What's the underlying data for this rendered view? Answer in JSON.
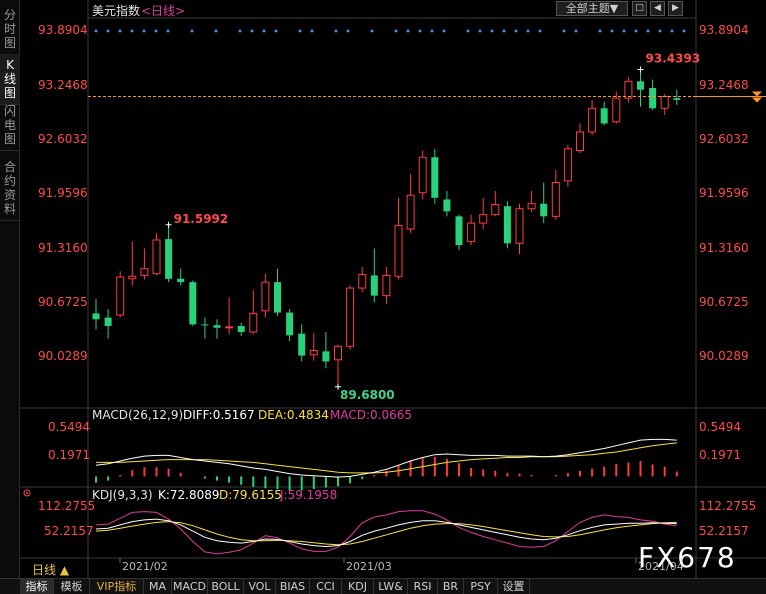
{
  "header": {
    "title": "美元指数",
    "period": "<日线>",
    "theme_button": "全部主题▼",
    "mini_buttons": [
      "□",
      "◀",
      "▶"
    ]
  },
  "left_nav": [
    {
      "label": "分时图",
      "active": false
    },
    {
      "label": "K线图",
      "active": true
    },
    {
      "label": "闪电图",
      "active": false
    },
    {
      "label": "合约资料",
      "active": false
    }
  ],
  "price_axis": {
    "ticks": [
      "93.8904",
      "93.2468",
      "92.6032",
      "91.9596",
      "91.3160",
      "90.6725",
      "90.0289"
    ]
  },
  "annotations": {
    "high": "93.4393",
    "mid_high": "91.5992",
    "low": "89.6800"
  },
  "macd": {
    "title": "MACD(26,12,9)",
    "diff": "DIFF:0.5167",
    "dea": "DEA:0.4834",
    "macd": "MACD:0.0665",
    "ticks": [
      "0.5494",
      "0.1971"
    ]
  },
  "kdj": {
    "title": "KDJ(9,3,3)",
    "k": "K:72.8089",
    "d": "D:79.6155",
    "j": "J:59.1958",
    "ticks": [
      "112.2755",
      "52.2157"
    ]
  },
  "x_axis": {
    "period": "日线 ▲",
    "dates": [
      "2021/02",
      "2021/03",
      "2021/04"
    ]
  },
  "bottom_tabs": [
    "指标",
    "模板",
    "VIP指标",
    "MA",
    "MACD",
    "BOLL",
    "VOL",
    "BIAS",
    "CCI",
    "KDJ",
    "LW&",
    "RSI",
    "BR",
    "PSY",
    "设置"
  ],
  "watermark": "FX678",
  "colors": {
    "up": "#ff3b3b",
    "down": "#28d27a",
    "diff": "#ffffff",
    "dea": "#ffe033",
    "macd": "#e03aa0",
    "current_price_line": "#ff9a1e"
  },
  "chart_data": {
    "type": "candlestick",
    "title": "美元指数 <日线>",
    "ylim": [
      89.5,
      94.05
    ],
    "y_ticks": [
      93.8904,
      93.2468,
      92.6032,
      91.9596,
      91.316,
      90.6725,
      90.0289
    ],
    "x_labels": [
      "2021/02",
      "2021/03",
      "2021/04"
    ],
    "current_price": 93.12,
    "candles": [
      {
        "o": 90.55,
        "c": 90.48,
        "h": 90.72,
        "l": 90.36
      },
      {
        "o": 90.5,
        "c": 90.4,
        "h": 90.6,
        "l": 90.25
      },
      {
        "o": 90.53,
        "c": 90.98,
        "h": 91.05,
        "l": 90.5
      },
      {
        "o": 90.96,
        "c": 90.99,
        "h": 91.4,
        "l": 90.88
      },
      {
        "o": 91.0,
        "c": 91.08,
        "h": 91.32,
        "l": 90.95
      },
      {
        "o": 91.02,
        "c": 91.42,
        "h": 91.5,
        "l": 91.0
      },
      {
        "o": 91.43,
        "c": 90.96,
        "h": 91.6,
        "l": 90.92
      },
      {
        "o": 90.96,
        "c": 90.92,
        "h": 91.08,
        "l": 90.88
      },
      {
        "o": 90.92,
        "c": 90.42,
        "h": 90.94,
        "l": 90.4
      },
      {
        "o": 90.42,
        "c": 90.41,
        "h": 90.5,
        "l": 90.25
      },
      {
        "o": 90.41,
        "c": 90.38,
        "h": 90.48,
        "l": 90.25
      },
      {
        "o": 90.38,
        "c": 90.39,
        "h": 90.74,
        "l": 90.3
      },
      {
        "o": 90.4,
        "c": 90.33,
        "h": 90.44,
        "l": 90.28
      },
      {
        "o": 90.33,
        "c": 90.55,
        "h": 90.82,
        "l": 90.3
      },
      {
        "o": 90.58,
        "c": 90.92,
        "h": 91.02,
        "l": 90.5
      },
      {
        "o": 90.92,
        "c": 90.56,
        "h": 91.08,
        "l": 90.52
      },
      {
        "o": 90.56,
        "c": 90.29,
        "h": 90.6,
        "l": 90.22
      },
      {
        "o": 90.31,
        "c": 90.05,
        "h": 90.42,
        "l": 89.98
      },
      {
        "o": 90.06,
        "c": 90.11,
        "h": 90.32,
        "l": 89.99
      },
      {
        "o": 90.1,
        "c": 89.98,
        "h": 90.33,
        "l": 89.9
      },
      {
        "o": 90.0,
        "c": 90.16,
        "h": 90.18,
        "l": 89.68
      },
      {
        "o": 90.16,
        "c": 90.85,
        "h": 90.88,
        "l": 90.12
      },
      {
        "o": 90.85,
        "c": 91.01,
        "h": 91.1,
        "l": 90.8
      },
      {
        "o": 91.0,
        "c": 90.76,
        "h": 91.32,
        "l": 90.68
      },
      {
        "o": 90.76,
        "c": 91.0,
        "h": 91.1,
        "l": 90.66
      },
      {
        "o": 90.99,
        "c": 91.59,
        "h": 91.92,
        "l": 90.95
      },
      {
        "o": 91.55,
        "c": 91.95,
        "h": 92.2,
        "l": 91.5
      },
      {
        "o": 91.98,
        "c": 92.4,
        "h": 92.48,
        "l": 91.9
      },
      {
        "o": 92.4,
        "c": 91.92,
        "h": 92.5,
        "l": 91.85
      },
      {
        "o": 91.9,
        "c": 91.76,
        "h": 92.0,
        "l": 91.7
      },
      {
        "o": 91.7,
        "c": 91.36,
        "h": 91.72,
        "l": 91.3
      },
      {
        "o": 91.4,
        "c": 91.62,
        "h": 91.72,
        "l": 91.36
      },
      {
        "o": 91.62,
        "c": 91.72,
        "h": 91.92,
        "l": 91.55
      },
      {
        "o": 91.72,
        "c": 91.84,
        "h": 92.0,
        "l": 91.7
      },
      {
        "o": 91.82,
        "c": 91.38,
        "h": 91.88,
        "l": 91.32
      },
      {
        "o": 91.38,
        "c": 91.79,
        "h": 91.85,
        "l": 91.25
      },
      {
        "o": 91.79,
        "c": 91.85,
        "h": 92.0,
        "l": 91.75
      },
      {
        "o": 91.85,
        "c": 91.7,
        "h": 92.1,
        "l": 91.62
      },
      {
        "o": 91.7,
        "c": 92.1,
        "h": 92.25,
        "l": 91.66
      },
      {
        "o": 92.12,
        "c": 92.5,
        "h": 92.55,
        "l": 92.05
      },
      {
        "o": 92.48,
        "c": 92.7,
        "h": 92.8,
        "l": 92.45
      },
      {
        "o": 92.7,
        "c": 92.98,
        "h": 93.08,
        "l": 92.66
      },
      {
        "o": 92.98,
        "c": 92.8,
        "h": 93.06,
        "l": 92.78
      },
      {
        "o": 92.82,
        "c": 93.1,
        "h": 93.18,
        "l": 92.8
      },
      {
        "o": 93.1,
        "c": 93.3,
        "h": 93.35,
        "l": 93.05
      },
      {
        "o": 93.3,
        "c": 93.2,
        "h": 93.44,
        "l": 93.0
      },
      {
        "o": 93.22,
        "c": 92.98,
        "h": 93.32,
        "l": 92.96
      },
      {
        "o": 92.98,
        "c": 93.12,
        "h": 93.15,
        "l": 92.9
      },
      {
        "o": 93.1,
        "c": 93.08,
        "h": 93.2,
        "l": 93.02
      }
    ],
    "macd": {
      "ylim": [
        -0.08,
        0.75
      ],
      "diff": [
        0.16,
        0.18,
        0.22,
        0.26,
        0.29,
        0.3,
        0.3,
        0.27,
        0.24,
        0.22,
        0.2,
        0.18,
        0.15,
        0.12,
        0.1,
        0.07,
        0.04,
        0.02,
        0.01,
        0.0,
        -0.01,
        0.0,
        0.03,
        0.06,
        0.1,
        0.16,
        0.22,
        0.27,
        0.31,
        0.32,
        0.31,
        0.3,
        0.3,
        0.3,
        0.29,
        0.29,
        0.29,
        0.28,
        0.29,
        0.31,
        0.34,
        0.37,
        0.4,
        0.44,
        0.48,
        0.52,
        0.53,
        0.53,
        0.52
      ],
      "dea": [
        0.2,
        0.2,
        0.2,
        0.21,
        0.22,
        0.23,
        0.24,
        0.24,
        0.24,
        0.24,
        0.23,
        0.22,
        0.21,
        0.2,
        0.18,
        0.16,
        0.14,
        0.12,
        0.1,
        0.08,
        0.06,
        0.05,
        0.05,
        0.05,
        0.06,
        0.08,
        0.11,
        0.14,
        0.17,
        0.2,
        0.22,
        0.24,
        0.25,
        0.26,
        0.27,
        0.27,
        0.28,
        0.28,
        0.28,
        0.29,
        0.3,
        0.31,
        0.33,
        0.35,
        0.38,
        0.41,
        0.44,
        0.46,
        0.48
      ],
      "hist": [
        -0.09,
        -0.06,
        0.02,
        0.09,
        0.13,
        0.13,
        0.11,
        0.05,
        0.0,
        -0.03,
        -0.06,
        -0.09,
        -0.12,
        -0.15,
        -0.17,
        -0.18,
        -0.2,
        -0.2,
        -0.18,
        -0.16,
        -0.14,
        -0.1,
        -0.04,
        0.02,
        0.08,
        0.16,
        0.22,
        0.26,
        0.28,
        0.25,
        0.19,
        0.12,
        0.1,
        0.08,
        0.05,
        0.04,
        0.02,
        0.0,
        0.02,
        0.05,
        0.08,
        0.11,
        0.14,
        0.18,
        0.2,
        0.22,
        0.17,
        0.14,
        0.07
      ]
    },
    "kdj": {
      "ylim": [
        -5,
        130
      ],
      "k": [
        60,
        62,
        70,
        78,
        82,
        84,
        80,
        70,
        55,
        40,
        32,
        28,
        26,
        30,
        36,
        35,
        30,
        24,
        20,
        18,
        20,
        30,
        45,
        55,
        62,
        70,
        76,
        80,
        80,
        76,
        70,
        64,
        58,
        52,
        46,
        40,
        36,
        34,
        38,
        46,
        56,
        64,
        70,
        72,
        74,
        74,
        75,
        74,
        73
      ],
      "d": [
        55,
        57,
        62,
        67,
        72,
        76,
        78,
        75,
        68,
        58,
        48,
        40,
        34,
        32,
        32,
        33,
        32,
        30,
        27,
        24,
        22,
        24,
        30,
        38,
        46,
        54,
        62,
        68,
        72,
        73,
        73,
        70,
        66,
        61,
        56,
        51,
        46,
        42,
        41,
        42,
        46,
        52,
        58,
        63,
        67,
        70,
        73,
        75,
        76
      ],
      "j": [
        70,
        72,
        86,
        100,
        102,
        100,
        84,
        60,
        30,
        5,
        0,
        4,
        10,
        26,
        44,
        39,
        26,
        12,
        6,
        6,
        16,
        42,
        75,
        89,
        94,
        102,
        104,
        104,
        96,
        82,
        64,
        52,
        42,
        34,
        26,
        18,
        16,
        18,
        32,
        54,
        76,
        88,
        94,
        90,
        88,
        82,
        79,
        72,
        68
      ]
    }
  }
}
